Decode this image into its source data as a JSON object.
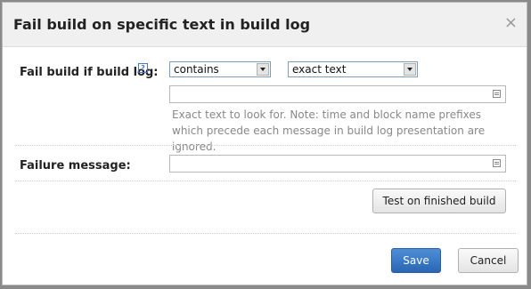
{
  "dialog": {
    "title": "Fail build on specific text in build log",
    "close_glyph": "×"
  },
  "form": {
    "fail_label": "Fail build if build log:",
    "help_glyph": "?",
    "condition_select": {
      "selected": "contains",
      "options": [
        "contains"
      ]
    },
    "match_select": {
      "selected": "exact text",
      "options": [
        "exact text"
      ]
    },
    "pattern_value": "",
    "note": "Exact text to look for. Note: time and block name prefixes which precede each message in build log presentation are ignored.",
    "failure_label": "Failure message:",
    "failure_value": ""
  },
  "buttons": {
    "test": "Test on finished build",
    "save": "Save",
    "cancel": "Cancel"
  },
  "icons": {
    "help": "help-icon",
    "close": "close-icon",
    "expand": "expand-field-icon",
    "dropdown": "chevron-down-icon"
  },
  "colors": {
    "primary": "#2a66b4",
    "note_text": "#888888"
  }
}
